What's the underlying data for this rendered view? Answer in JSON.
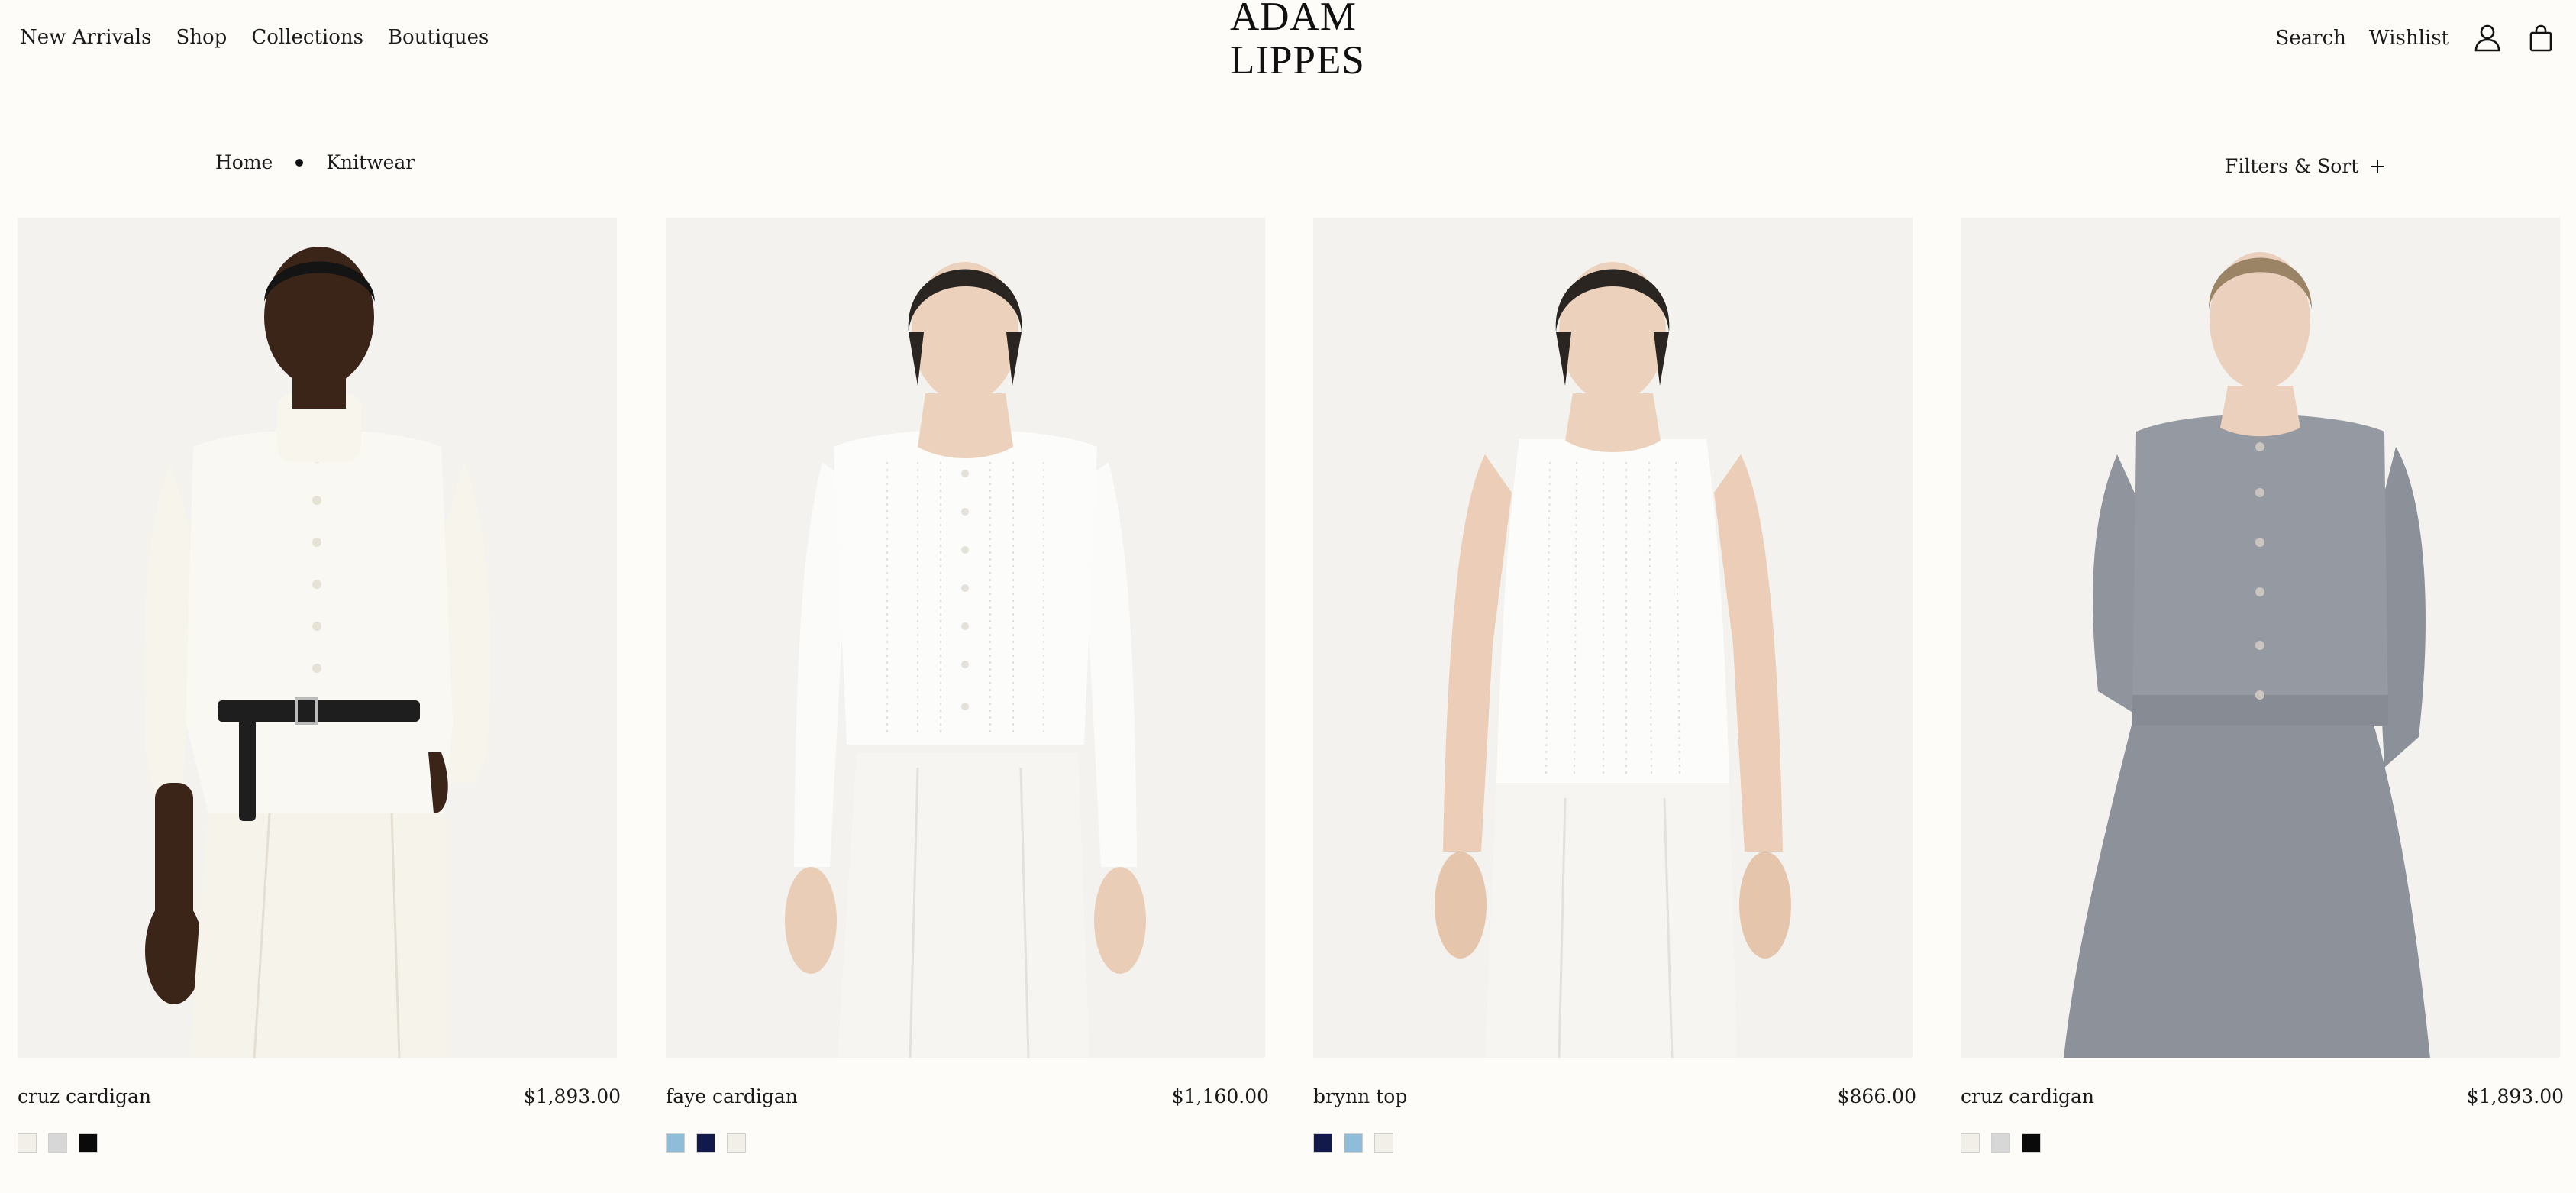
{
  "nav": {
    "left": [
      "New Arrivals",
      "Shop",
      "Collections",
      "Boutiques"
    ],
    "search": "Search",
    "wishlist": "Wishlist",
    "icons": [
      "account-icon",
      "bag-icon"
    ]
  },
  "logo": {
    "line1": "ADAM",
    "line2": "LIPPES"
  },
  "breadcrumb": {
    "home": "Home",
    "current": "Knitwear"
  },
  "filters": {
    "label": "Filters & Sort"
  },
  "products": [
    {
      "name": "cruz cardigan",
      "price": "$1,893.00",
      "swatches": [
        "#f1efe7",
        "#d7d7d7",
        "#0a0a0a"
      ],
      "garment": "ivory-turtleneck-cardigan"
    },
    {
      "name": "faye cardigan",
      "price": "$1,160.00",
      "swatches": [
        "#8fbcd9",
        "#111a4a",
        "#f1efe7"
      ],
      "garment": "white-pointelle-cardigan"
    },
    {
      "name": "brynn top",
      "price": "$866.00",
      "swatches": [
        "#111a4a",
        "#8fbcd9",
        "#f1efe7"
      ],
      "garment": "white-pointelle-tank"
    },
    {
      "name": "cruz cardigan",
      "price": "$1,893.00",
      "swatches": [
        "#f1efe7",
        "#d7d7d7",
        "#0a0a0a"
      ],
      "garment": "grey-mohair-cardigan"
    }
  ],
  "colors": {
    "background": "#fdfcf9",
    "image_bg": "#f2f1ef",
    "text": "#1a1a1a"
  }
}
